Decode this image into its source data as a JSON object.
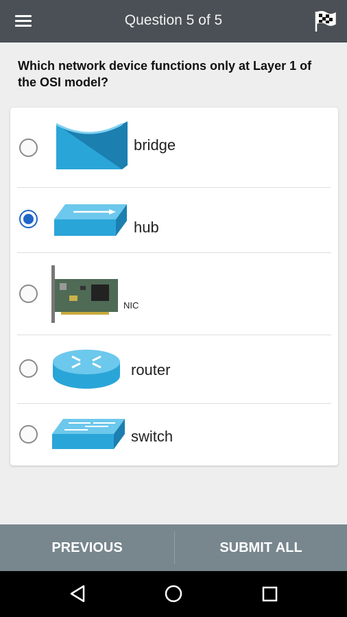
{
  "header": {
    "title": "Question 5 of 5",
    "menu_icon": "hamburger-menu-icon",
    "flag_icon": "checkered-flag-icon"
  },
  "question": {
    "text": "Which network device functions only at Layer 1 of the OSI model?"
  },
  "options": [
    {
      "label": "bridge",
      "icon": "bridge-device-icon",
      "selected": false
    },
    {
      "label": "hub",
      "icon": "hub-device-icon",
      "selected": true
    },
    {
      "label": "NIC",
      "icon": "nic-card-icon",
      "selected": false
    },
    {
      "label": "router",
      "icon": "router-device-icon",
      "selected": false
    },
    {
      "label": "switch",
      "icon": "switch-device-icon",
      "selected": false
    }
  ],
  "footer": {
    "previous_label": "PREVIOUS",
    "submit_label": "SUBMIT ALL"
  },
  "system_nav": {
    "back_icon": "back-triangle-icon",
    "home_icon": "home-circle-icon",
    "recents_icon": "recents-square-icon"
  },
  "colors": {
    "header_bg": "#4a5055",
    "device_blue": "#2aa5d8",
    "radio_selected": "#1e66c8",
    "footer_bg": "#78868e"
  }
}
